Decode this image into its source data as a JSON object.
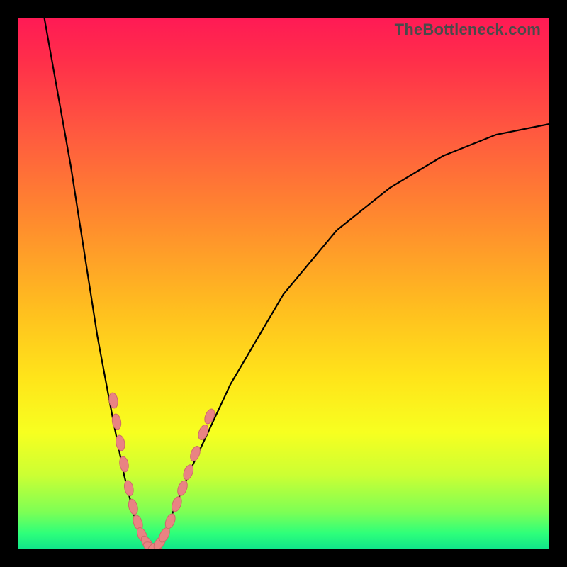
{
  "attribution": "TheBottleneck.com",
  "colors": {
    "background": "#000000",
    "gradient_top": "#ff1a55",
    "gradient_bottom": "#10e58a",
    "curve": "#000000",
    "beads_fill": "#e98383",
    "beads_stroke": "#ce6a6a"
  },
  "chart_data": {
    "type": "line",
    "title": "",
    "xlabel": "",
    "ylabel": "",
    "xlim": [
      0,
      100
    ],
    "ylim": [
      0,
      100
    ],
    "notes": "Bottleneck-style curve. Y≈100 means high bottleneck (red), Y≈0 means no bottleneck (green). Minimum sits near x≈25. Values estimated from pixel positions; no axis ticks are rendered in the image.",
    "series": [
      {
        "name": "bottleneck-curve",
        "x": [
          5,
          10,
          15,
          18,
          20,
          22,
          24,
          25,
          26,
          28,
          30,
          33,
          40,
          50,
          60,
          70,
          80,
          90,
          100
        ],
        "y": [
          100,
          72,
          40,
          24,
          14,
          6,
          1,
          0,
          1,
          4,
          9,
          16,
          31,
          48,
          60,
          68,
          74,
          78,
          80
        ]
      }
    ],
    "markers": {
      "name": "highlighted-points",
      "note": "Salmon lozenge markers clustered around the curve minimum on both branches.",
      "points": [
        {
          "x": 18.0,
          "y": 28.0
        },
        {
          "x": 18.6,
          "y": 24.0
        },
        {
          "x": 19.3,
          "y": 20.0
        },
        {
          "x": 20.0,
          "y": 16.0
        },
        {
          "x": 20.9,
          "y": 11.5
        },
        {
          "x": 21.7,
          "y": 8.0
        },
        {
          "x": 22.6,
          "y": 5.0
        },
        {
          "x": 23.4,
          "y": 2.7
        },
        {
          "x": 24.3,
          "y": 1.2
        },
        {
          "x": 25.0,
          "y": 0.4
        },
        {
          "x": 25.9,
          "y": 0.4
        },
        {
          "x": 26.7,
          "y": 1.2
        },
        {
          "x": 27.6,
          "y": 2.7
        },
        {
          "x": 28.7,
          "y": 5.3
        },
        {
          "x": 29.9,
          "y": 8.5
        },
        {
          "x": 31.0,
          "y": 11.5
        },
        {
          "x": 32.1,
          "y": 14.5
        },
        {
          "x": 33.4,
          "y": 18.0
        },
        {
          "x": 34.9,
          "y": 22.0
        },
        {
          "x": 36.1,
          "y": 25.0
        }
      ]
    }
  }
}
